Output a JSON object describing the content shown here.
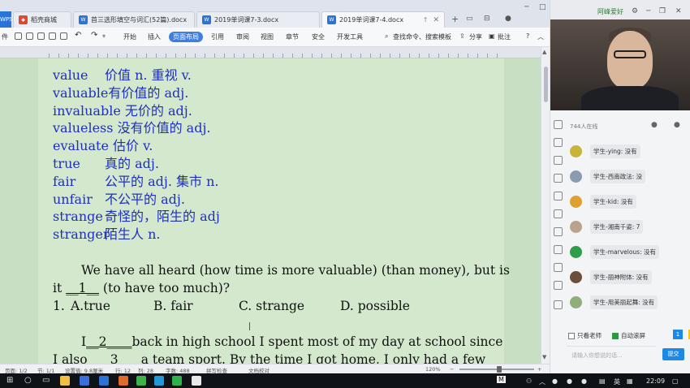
{
  "window": {
    "tabs": [
      {
        "label": "稻壳商城",
        "active": false
      },
      {
        "label": "首三选形填空与词汇(52篇).docx",
        "active": false
      },
      {
        "label": "2019单词课7-3.docx",
        "active": false
      },
      {
        "label": "2019单词课7-4.docx",
        "active": true
      }
    ],
    "app_badge": "WPS",
    "new_tab": "+"
  },
  "ribbon": {
    "file_menu": "件",
    "tabs": [
      "开始",
      "插入",
      "页面布局",
      "引用",
      "审阅",
      "视图",
      "章节",
      "安全",
      "开发工具"
    ],
    "active_tab": "页面布局",
    "search_label": "查找命令、搜索模板",
    "share_label": "分享",
    "comment_label": "批注",
    "help": "?"
  },
  "document": {
    "vocab": [
      {
        "word": "value",
        "meaning": "价值 n.    重视 v."
      },
      {
        "word": "valuable",
        "meaning": "有价值的 adj."
      },
      {
        "word": "invaluable",
        "meaning": " 无价的 adj."
      },
      {
        "word": "valueless",
        "meaning": " 没有价值的 adj."
      },
      {
        "word": "evaluate",
        "meaning": " 估价 v."
      },
      {
        "word": "true",
        "meaning": "真的 adj."
      },
      {
        "word": "fair",
        "meaning": "公平的 adj.  集市 n."
      },
      {
        "word": "unfair",
        "meaning": "不公平的 adj."
      },
      {
        "word": "strange",
        "meaning": "奇怪的，陌生的 adj"
      },
      {
        "word": "stranger",
        "meaning": "陌生人 n."
      }
    ],
    "para1_line1": "We have all heard (how time is more valuable) (than money), but is",
    "para1_line2_pre": "it ",
    "para1_blank": "__1__",
    "para1_line2_post": "  (to have too much)?",
    "q1": {
      "num": "1.",
      "a": "A.true",
      "b": "B. fair",
      "c": "C. strange",
      "d": "D. possible"
    },
    "para2_line1_pre": "I",
    "para2_blank": "__2____",
    "para2_line1_post": "back in high school I spent most of my day at school since",
    "para2_line2": "I also ___3___ a team sport. By the time I got home, I only had a few"
  },
  "statusbar": {
    "page": "页面: 1/2",
    "section": "节: 1/1",
    "position": "设置值: 9.8厘米",
    "row": "行: 12",
    "col": "列: 28",
    "words": "字数: 488",
    "spell": "拼写检查",
    "proof": "文档校对",
    "zoom": "120%"
  },
  "panel": {
    "username": "阿峰爱好",
    "viewers": "744人在线",
    "chat": [
      {
        "name": "学生-ying:",
        "text": "没有",
        "color": "#c9b43a"
      },
      {
        "name": "学生-西南政法:",
        "text": "没",
        "color": "#8a9bb0"
      },
      {
        "name": "学生-kid:",
        "text": "没有",
        "color": "#e0a030"
      },
      {
        "name": "学生-湘南千姿:",
        "text": "7",
        "color": "#b8a48a"
      },
      {
        "name": "学生-marvelous:",
        "text": "没有",
        "color": "#2e9e4a"
      },
      {
        "name": "学生-丽神附体:",
        "text": "没有",
        "color": "#6b4f3a"
      },
      {
        "name": "学生-用美丽起舞:",
        "text": "没有",
        "color": "#8fae7a"
      }
    ],
    "only_teacher": "只看老师",
    "auto_scroll": "自动滚屏",
    "input_placeholder": "请输入你想说的话...",
    "send": "提交",
    "badge_num": "1"
  },
  "taskbar": {
    "ime": "英",
    "time": "22:09",
    "m_label": "M"
  }
}
